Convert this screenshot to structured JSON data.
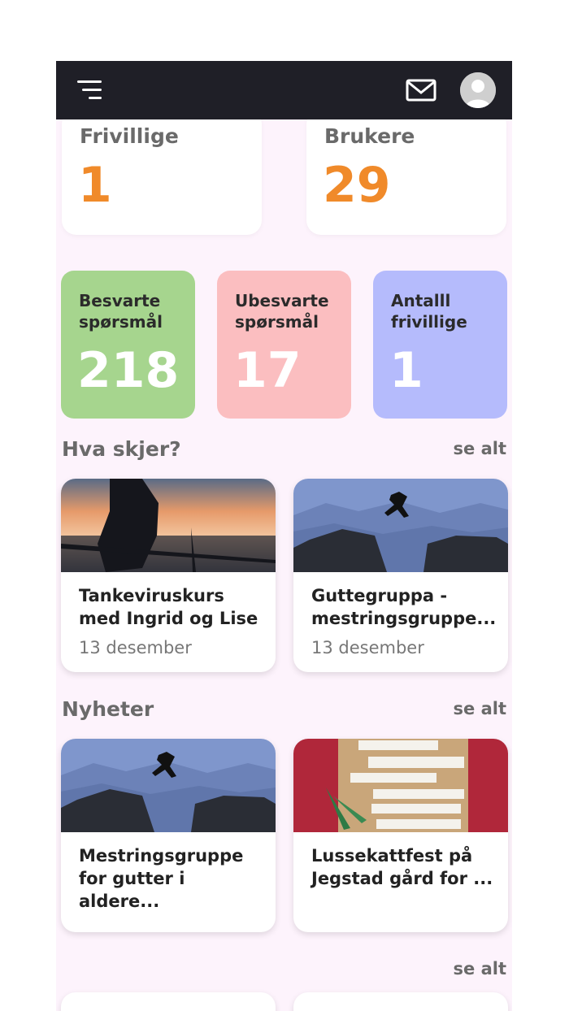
{
  "stats_top": [
    {
      "label": "Frivillige",
      "value": "1"
    },
    {
      "label": "Brukere",
      "value": "29"
    }
  ],
  "tiles": [
    {
      "label": "Besvarte spørsmål",
      "value": "218",
      "color": "#a6d58e"
    },
    {
      "label": "Ubesvarte spørsmål",
      "value": "17",
      "color": "#fbbec0"
    },
    {
      "label": "Antalll frivillige",
      "value": "1",
      "color": "#b5bbfc"
    }
  ],
  "events": {
    "title": "Hva skjer?",
    "see_all": "se alt",
    "items": [
      {
        "title": "Tankeviruskurs med Ingrid og Lise",
        "date": "13 desember",
        "image": "sunset-silhouette-photo"
      },
      {
        "title": "Guttegruppa - mestringsgruppe...",
        "date": "13 desember",
        "image": "mountain-jump-photo"
      }
    ]
  },
  "news": {
    "title": "Nyheter",
    "see_all": "se alt",
    "items": [
      {
        "title": "Mestringsgruppe for gutter i aldere...",
        "image": "mountain-jump-photo"
      },
      {
        "title": "Lussekattfest på Jegstad gård for ...",
        "image": "handwritten-notes-photo"
      }
    ]
  },
  "third_section": {
    "see_all": "se alt"
  },
  "colors": {
    "topbar": "#1f1f27",
    "accent": "#f08a2a",
    "background": "#fdf3fc"
  }
}
